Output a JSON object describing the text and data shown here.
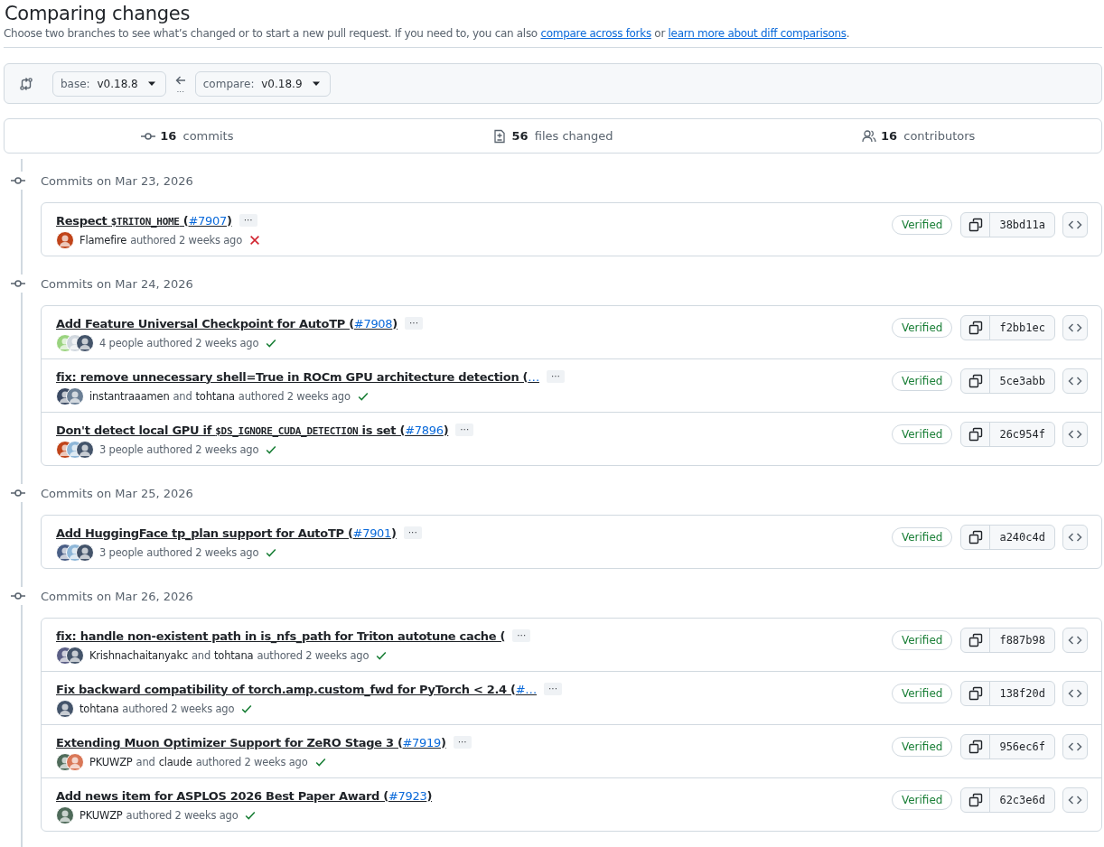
{
  "page": {
    "title": "Comparing changes",
    "description": [
      {
        "kind": "text",
        "text": "Choose two branches to see what’s changed or to start a new pull request. If you need to, you can also "
      },
      {
        "kind": "link",
        "text": "compare across forks"
      },
      {
        "kind": "text",
        "text": " or "
      },
      {
        "kind": "link",
        "text": "learn more about diff comparisons"
      },
      {
        "kind": "text",
        "text": "."
      }
    ]
  },
  "compare_bar": {
    "base": {
      "label": "base:",
      "value": "v0.18.8"
    },
    "arrow_dots": "...",
    "compare": {
      "label": "compare:",
      "value": "v0.18.9"
    }
  },
  "stats": [
    {
      "kind": "commits",
      "count": "16",
      "label": "commits"
    },
    {
      "kind": "files",
      "count": "56",
      "label": "files changed"
    },
    {
      "kind": "contributors",
      "count": "16",
      "label": "contributors"
    }
  ],
  "groups": [
    {
      "heading": "Commits on Mar 23, 2026",
      "commits": [
        {
          "title": [
            {
              "kind": "text",
              "text": "Respect "
            },
            {
              "kind": "code",
              "text": "$TRITON_HOME"
            },
            {
              "kind": "text",
              "text": " ("
            },
            {
              "kind": "link",
              "text": "#7907"
            },
            {
              "kind": "text",
              "text": ")"
            }
          ],
          "more": "···",
          "avatars": [
            {
              "kind": "avatar",
              "color": "#c0441a"
            }
          ],
          "authors": [
            {
              "kind": "name",
              "text": "Flamefire"
            }
          ],
          "authored": "authored",
          "time": "2 weeks ago",
          "checks_passed": false,
          "badge": "Verified",
          "sha": "38bd11a"
        }
      ]
    },
    {
      "heading": "Commits on Mar 24, 2026",
      "commits": [
        {
          "title": [
            {
              "kind": "text",
              "text": "Add Feature Universal Checkpoint for AutoTP ("
            },
            {
              "kind": "link",
              "text": "#7908"
            },
            {
              "kind": "text",
              "text": ")"
            }
          ],
          "more": "···",
          "avatars": [
            {
              "kind": "avatar",
              "color": "#9ad37f"
            },
            {
              "kind": "avatar",
              "color": "#d0d7de"
            },
            {
              "kind": "avatar",
              "color": "#44546a"
            }
          ],
          "authors": [
            {
              "kind": "plain",
              "text": "4 people"
            }
          ],
          "authored": "authored",
          "time": "2 weeks ago",
          "checks_passed": true,
          "badge": "Verified",
          "sha": "f2bb1ec"
        },
        {
          "title": [
            {
              "kind": "text",
              "text": "fix: remove unnecessary shell=True in ROCm GPU architecture detection ("
            },
            {
              "kind": "link",
              "text": "…"
            }
          ],
          "more": "···",
          "avatars": [
            {
              "kind": "avatar",
              "color": "#3b4a63"
            },
            {
              "kind": "avatar",
              "color": "#6b7f95"
            }
          ],
          "authors": [
            {
              "kind": "name",
              "text": "instantraaamen"
            },
            {
              "kind": "plain",
              "text": "and"
            },
            {
              "kind": "name",
              "text": "tohtana"
            }
          ],
          "authored": "authored",
          "time": "2 weeks ago",
          "checks_passed": true,
          "badge": "Verified",
          "sha": "5ce3abb"
        },
        {
          "title": [
            {
              "kind": "text",
              "text": "Don't detect local GPU if "
            },
            {
              "kind": "code",
              "text": "$DS_IGNORE_CUDA_DETECTION"
            },
            {
              "kind": "text",
              "text": " is set ("
            },
            {
              "kind": "link",
              "text": "#7896"
            },
            {
              "kind": "text",
              "text": ")"
            }
          ],
          "more": "···",
          "avatars": [
            {
              "kind": "avatar",
              "color": "#c0441a"
            },
            {
              "kind": "avatar",
              "color": "#8fb7d8"
            },
            {
              "kind": "avatar",
              "color": "#44546a"
            }
          ],
          "authors": [
            {
              "kind": "plain",
              "text": "3 people"
            }
          ],
          "authored": "authored",
          "time": "2 weeks ago",
          "checks_passed": true,
          "badge": "Verified",
          "sha": "26c954f"
        }
      ]
    },
    {
      "heading": "Commits on Mar 25, 2026",
      "commits": [
        {
          "title": [
            {
              "kind": "text",
              "text": "Add HuggingFace tp_plan support for AutoTP ("
            },
            {
              "kind": "link",
              "text": "#7901"
            },
            {
              "kind": "text",
              "text": ")"
            }
          ],
          "more": "···",
          "avatars": [
            {
              "kind": "avatar",
              "color": "#4a5f86"
            },
            {
              "kind": "avatar",
              "color": "#8fb7d8"
            },
            {
              "kind": "avatar",
              "color": "#44546a"
            }
          ],
          "authors": [
            {
              "kind": "plain",
              "text": "3 people"
            }
          ],
          "authored": "authored",
          "time": "2 weeks ago",
          "checks_passed": true,
          "badge": "Verified",
          "sha": "a240c4d"
        }
      ]
    },
    {
      "heading": "Commits on Mar 26, 2026",
      "commits": [
        {
          "title": [
            {
              "kind": "text",
              "text": "fix: handle non-existent path in is_nfs_path for Triton autotune cache ("
            }
          ],
          "more": "···",
          "avatars": [
            {
              "kind": "avatar",
              "color": "#5b5f86"
            },
            {
              "kind": "avatar",
              "color": "#44546a"
            }
          ],
          "authors": [
            {
              "kind": "name",
              "text": "Krishnachaitanyakc"
            },
            {
              "kind": "plain",
              "text": "and"
            },
            {
              "kind": "name",
              "text": "tohtana"
            }
          ],
          "authored": "authored",
          "time": "2 weeks ago",
          "checks_passed": true,
          "badge": "Verified",
          "sha": "f887b98"
        },
        {
          "title": [
            {
              "kind": "text",
              "text": "Fix backward compatibility of torch.amp.custom_fwd for PyTorch < 2.4 ("
            },
            {
              "kind": "link",
              "text": "#…"
            }
          ],
          "more": "···",
          "avatars": [
            {
              "kind": "avatar",
              "color": "#44546a"
            }
          ],
          "authors": [
            {
              "kind": "name",
              "text": "tohtana"
            }
          ],
          "authored": "authored",
          "time": "2 weeks ago",
          "checks_passed": true,
          "badge": "Verified",
          "sha": "138f20d"
        },
        {
          "title": [
            {
              "kind": "text",
              "text": "Extending Muon Optimizer Support for ZeRO Stage 3 ("
            },
            {
              "kind": "link",
              "text": "#7919"
            },
            {
              "kind": "text",
              "text": ")"
            }
          ],
          "more": "···",
          "avatars": [
            {
              "kind": "avatar",
              "color": "#4f6b5a"
            },
            {
              "kind": "avatar",
              "color": "#d97757"
            }
          ],
          "authors": [
            {
              "kind": "name",
              "text": "PKUWZP"
            },
            {
              "kind": "plain",
              "text": "and"
            },
            {
              "kind": "name",
              "text": "claude"
            }
          ],
          "authored": "authored",
          "time": "2 weeks ago",
          "checks_passed": true,
          "badge": "Verified",
          "sha": "956ec6f"
        },
        {
          "title": [
            {
              "kind": "text",
              "text": "Add news item for ASPLOS 2026 Best Paper Award ("
            },
            {
              "kind": "link",
              "text": "#7923"
            },
            {
              "kind": "text",
              "text": ")"
            }
          ],
          "avatars": [
            {
              "kind": "avatar",
              "color": "#4f6b5a"
            }
          ],
          "authors": [
            {
              "kind": "name",
              "text": "PKUWZP"
            }
          ],
          "authored": "authored",
          "time": "2 weeks ago",
          "checks_passed": true,
          "badge": "Verified",
          "sha": "62c3e6d"
        }
      ]
    }
  ]
}
